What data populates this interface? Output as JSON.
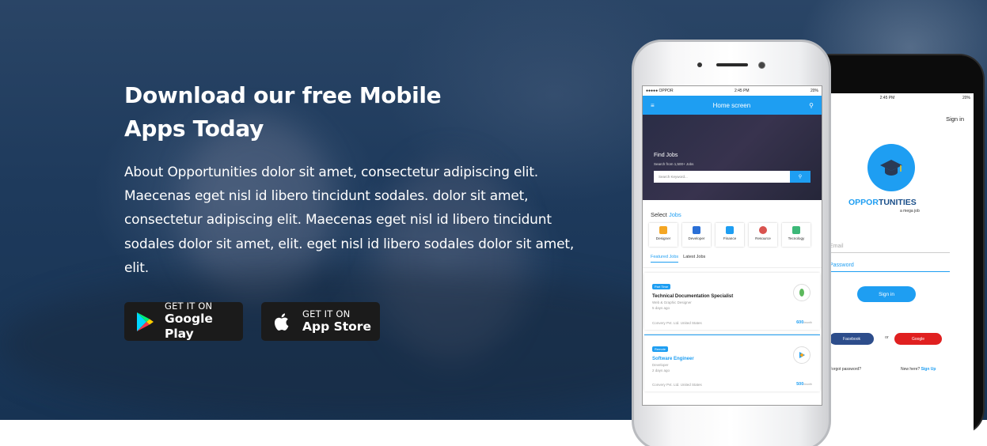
{
  "hero": {
    "title_line1": "Download our free Mobile",
    "title_line2": "Apps Today",
    "description": "About Opportunities dolor sit amet, consectetur adipiscing elit. Maecenas eget nisl id libero tincidunt sodales. dolor sit amet, consectetur adipiscing elit. Maecenas eget nisl id libero tincidunt sodales dolor sit amet, elit. eget nisl id libero sodales dolor sit amet, elit."
  },
  "buttons": {
    "google_play": {
      "small": "GET IT ON",
      "big": "Google Play",
      "icon": "google-play-icon"
    },
    "app_store": {
      "small": "GET IT ON",
      "big": "App Store",
      "icon": "apple-icon"
    }
  },
  "front_phone": {
    "carrier": "●●●●● OPPOR",
    "time": "2:45 PM",
    "battery": "20%",
    "header_title": "Home screen",
    "banner_title": "Find Jobs",
    "banner_sub": "Search from 1,500+ Jobs",
    "search_placeholder": "Search Keyword...",
    "select_prefix": "Select",
    "select_highlight": "Jobs",
    "categories": [
      "Designer",
      "Developer",
      "Finance",
      "Resource",
      "Tecnology"
    ],
    "tab_featured": "Featured Jobs",
    "tab_latest": "Latest Jobs",
    "jobs": [
      {
        "tag": "Part Time",
        "title": "Technical Documentation Specialist",
        "sub": "Web & Graphic Designer",
        "ago": "5 days ago",
        "location": "Convery Pvt. Ltd. United States",
        "price": "600",
        "unit": "/month"
      },
      {
        "tag": "Remote",
        "title": "Software Engineer",
        "sub": "Developer",
        "ago": "2 days ago",
        "location": "Convery Pvt. Ltd. United States",
        "price": "500",
        "unit": "/month"
      }
    ]
  },
  "back_phone": {
    "time": "2:45 PM",
    "battery": "20%",
    "sign_in_link": "Sign in",
    "brand_a": "OPPOR",
    "brand_b": "TUNITIES",
    "brand_tag": "a mega job",
    "email_label": "Email",
    "password_label": "Password",
    "sign_in_button": "Sign in",
    "facebook": "Facebook",
    "or": "or",
    "google": "Google",
    "forgot": "Forgot password?",
    "new_here": "New here?",
    "sign_up": "Sign Up"
  },
  "colors": {
    "accent": "#1e9ef2",
    "hero_overlay": "#1e3a5c",
    "button_bg": "#1b1b1b"
  }
}
